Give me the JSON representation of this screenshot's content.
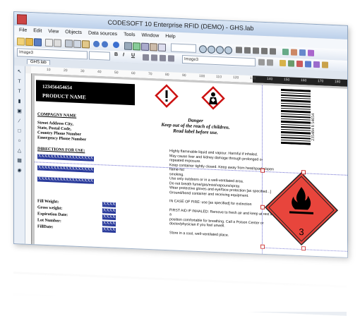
{
  "window": {
    "title": "CODESOFT 10 Enterprise RFID (DEMO) - GHS.lab"
  },
  "menu": [
    "File",
    "Edit",
    "View",
    "Objects",
    "Data sources",
    "Tools",
    "Window",
    "Help"
  ],
  "toolbar": {
    "font_combo": "Image3",
    "zoom_combo": "",
    "font_name": "Image3",
    "size": ""
  },
  "format_buttons": [
    "B",
    "I",
    "U"
  ],
  "doc_tab": "GHS.lab",
  "ruler": {
    "marks": [
      "10",
      "20",
      "30",
      "40",
      "50",
      "60",
      "70",
      "80",
      "90",
      "100",
      "110",
      "120",
      "130",
      "140",
      "150",
      "160",
      "170",
      "180",
      "190"
    ]
  },
  "label": {
    "product_id": "123456454654",
    "product_name": "PRODUCT NAME",
    "company": "COMPAGNY NAME",
    "address": [
      "Street Address City,",
      "State, Postal Code,",
      "Country Phone Number",
      "Emergency Phone Number"
    ],
    "directions_title": "DIRECTIONS FOR USE:",
    "placeholder": "XXXXXXXXXXXXXXXXXX",
    "fields": [
      {
        "label": "Fill Weight:",
        "value": "XXXX"
      },
      {
        "label": "Gross weight:",
        "value": "XXXX"
      },
      {
        "label": "Expiration Date:",
        "value": "XXXX"
      },
      {
        "label": "Lot Number:",
        "value": "XXXX"
      },
      {
        "label": "FillDate:",
        "value": "XXXX"
      }
    ],
    "signal_word": "Danger",
    "keep_out": "Keep out of the reach of children.",
    "read_label": "Read label before use.",
    "hazard_lines": [
      "Highly flammable liquid and vapour. Harmful if inhaled.",
      "May cause liver and kidney damage through prolonged or",
      "repeated exposure.",
      "Keep container tightly closed. Keep away from heat/sparks/open flame-No",
      "smoking.",
      "Use only outdoors or in a well-ventilated area.",
      "Do not breath fume/gas/mist/vapours/spray.",
      "Wear protective gloves and eye/face protection [as specified...]",
      "Ground/bond container and receiving equipment.",
      "",
      "IN CASE OF FIRE: use [as specified] for extinction",
      "",
      "FIRST AID IF INHALED: Remove to fresh air and keep at rest in a",
      "position comfortable for breathing. Call a Poison Center or",
      "doctor/physician if you feel unwell.",
      "",
      "Store in a cool, well-ventilated place."
    ],
    "barcode_text": "235484 8 54654",
    "class_number": "3"
  },
  "colors": {
    "accent": "#2a3b9c",
    "hazard_red": "#e8453c",
    "pictogram_border": "#cc1111"
  }
}
